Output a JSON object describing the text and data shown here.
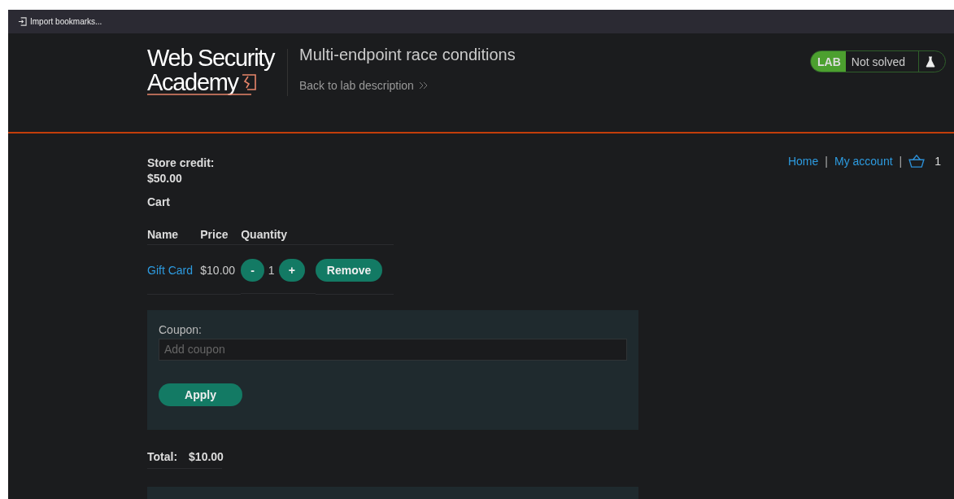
{
  "bookmarks_bar": {
    "items": [
      {
        "label": "Import bookmarks..."
      }
    ]
  },
  "header": {
    "logo": {
      "line_1": "Web Security",
      "line_2": "Academy"
    },
    "title": "Multi-endpoint race conditions",
    "back_link": "Back to lab description",
    "lab_badge": {
      "tag": "LAB",
      "status": "Not solved"
    }
  },
  "nav": {
    "links": [
      "Home",
      "My account"
    ],
    "separators": [
      "|",
      "|"
    ],
    "cart_count": "1"
  },
  "store_credit": {
    "label": "Store credit:",
    "amount": "$50.00"
  },
  "cart": {
    "title": "Cart",
    "columns": [
      "Name",
      "Price",
      "Quantity"
    ],
    "rows": [
      {
        "name": "Gift Card",
        "price": "$10.00",
        "decrement": "-",
        "quantity": "1",
        "increment": "+",
        "remove": "Remove"
      }
    ]
  },
  "coupon": {
    "label": "Coupon:",
    "placeholder": "Add coupon",
    "button": "Apply"
  },
  "total": {
    "label": "Total:",
    "amount": "$10.00"
  }
}
